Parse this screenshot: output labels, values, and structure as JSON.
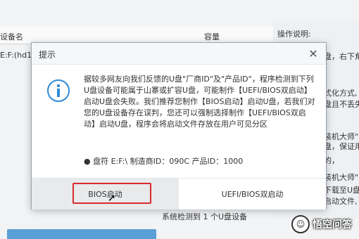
{
  "background": {
    "table": {
      "col_device": "设备名",
      "col_capacity": "容量",
      "row_device": "E:F:(hd1)S"
    },
    "right_panel": {
      "title": "操作说明:",
      "lines": [
        "盘，右下角",
        "式化方式,",
        "盘且不丢失",
        "装机大师\"",
        "盘，保证用",
        "的，",
        "装机大师\"",
        "下载至U盘",
        "启动文件,"
      ]
    },
    "status_text": "系统检测到 1 个U盘设备"
  },
  "watermark": {
    "text": "悟空问答"
  },
  "dialog": {
    "title": "提示",
    "message": "据较多网友向我们反馈的U盘\"厂商ID\"及\"产品ID\"，程序检测到下列U盘设备可能属于山寨或扩容U盘，可能制作【UEFI/BIOS双启动】启动U盘会失败。我们推荐您制作【BIOS启动】启动U盘，若我们对您的U盘设备存在误判，您还可以强制选择制作【UEFI/BIOS双启动】启动U盘，程序会将启动文件存放在用户可见分区",
    "device_info": "● 盘符 E:F:\\ 制造商ID：090C 产品ID：1000",
    "buttons": {
      "bios": "BIOS启动",
      "uefi": "UEFI/BIOS双启动"
    }
  },
  "colors": {
    "accent": "#2f8ad8",
    "highlight": "#d92b2b",
    "progress": "#5a9fd6"
  },
  "icons": {
    "info": "info-icon",
    "close": "close-icon",
    "cursor": "mouse-pointer-icon",
    "watermark_logo": "wukong-logo-icon"
  }
}
